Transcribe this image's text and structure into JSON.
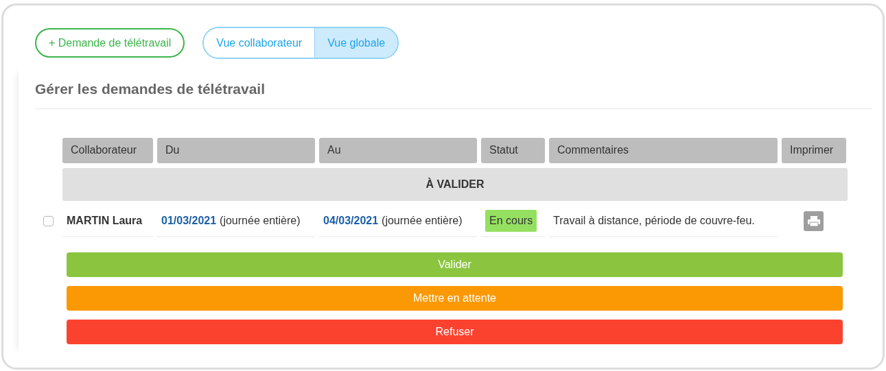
{
  "new_request_button": "+ Demande de télétravail",
  "view_tabs": [
    {
      "label": "Vue collaborateur",
      "selected": false
    },
    {
      "label": "Vue globale",
      "selected": true
    }
  ],
  "section_title": "Gérer les demandes de télétravail",
  "table": {
    "columns": [
      "Collaborateur",
      "Du",
      "Au",
      "Statut",
      "Commentaires",
      "Imprimer"
    ],
    "group": "À VALIDER",
    "rows": [
      {
        "checked": false,
        "employee": "MARTIN Laura",
        "from_date": "01/03/2021",
        "from_period": "(journée entière)",
        "to_date": "04/03/2021",
        "to_period": "(journée entière)",
        "status": "En cours",
        "comment": "Travail à distance, période de couvre-feu."
      }
    ]
  },
  "actions": [
    {
      "kind": "validate",
      "label": "Valider"
    },
    {
      "kind": "hold",
      "label": "Mettre en attente"
    },
    {
      "kind": "refuse",
      "label": "Refuser"
    }
  ]
}
